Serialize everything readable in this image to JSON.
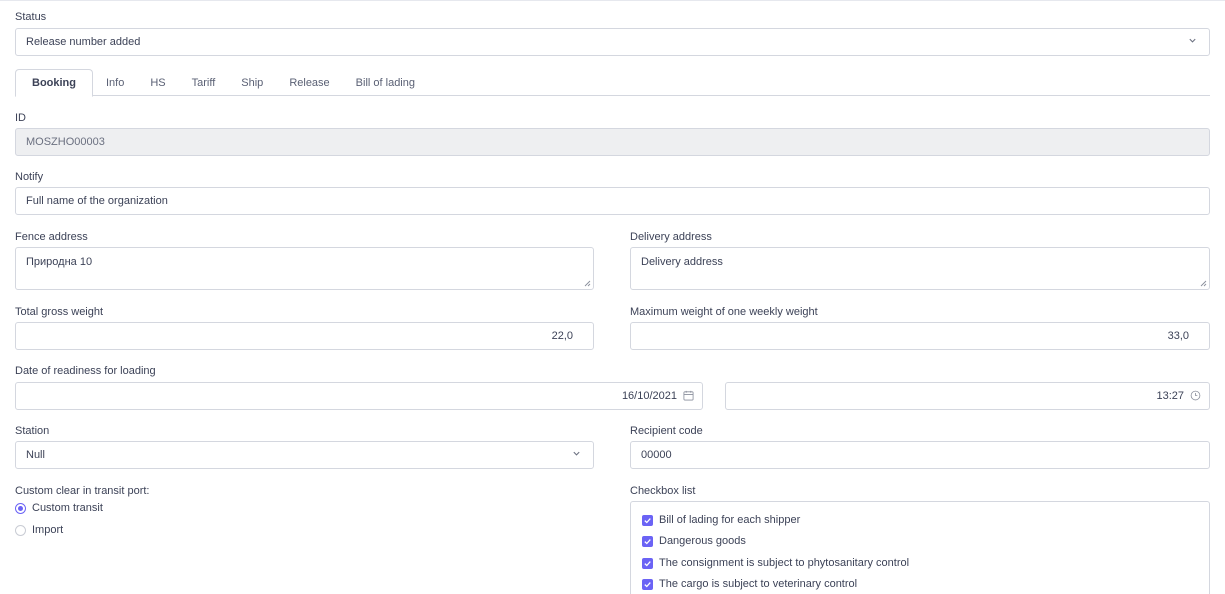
{
  "status": {
    "label": "Status",
    "value": "Release number added"
  },
  "tabs": [
    {
      "label": "Booking",
      "active": true
    },
    {
      "label": "Info"
    },
    {
      "label": "HS"
    },
    {
      "label": "Tariff"
    },
    {
      "label": "Ship"
    },
    {
      "label": "Release"
    },
    {
      "label": "Bill of lading"
    }
  ],
  "id_field": {
    "label": "ID",
    "value": "MOSZHO00003"
  },
  "notify": {
    "label": "Notify",
    "placeholder": "Full name of the organization"
  },
  "fence_address": {
    "label": "Fence address",
    "value": "Природна 10"
  },
  "delivery_address": {
    "label": "Delivery address",
    "placeholder": "Delivery address"
  },
  "total_gross_weight": {
    "label": "Total gross weight",
    "value": "22,0"
  },
  "max_weight": {
    "label": "Maximum weight of one weekly weight",
    "value": "33,0"
  },
  "readiness": {
    "label": "Date of readiness for loading",
    "date": "16/10/2021",
    "time": "13:27"
  },
  "station": {
    "label": "Station",
    "value": "Null"
  },
  "recipient_code": {
    "label": "Recipient code",
    "value": "00000"
  },
  "custom_clear": {
    "label": "Custom clear in transit port:",
    "options": [
      {
        "label": "Custom transit",
        "checked": true
      },
      {
        "label": "Import",
        "checked": false
      }
    ]
  },
  "checkbox_list": {
    "label": "Checkbox list",
    "items": [
      {
        "label": "Bill of lading for each shipper",
        "checked": true
      },
      {
        "label": "Dangerous goods",
        "checked": true
      },
      {
        "label": "The consignment is subject to phytosanitary control",
        "checked": true
      },
      {
        "label": "The cargo is subject to veterinary control",
        "checked": true
      }
    ]
  },
  "colors": {
    "accent": "#6b63f5",
    "border": "#d4d7df",
    "disabled_bg": "#eeeff1",
    "text": "#3c4257"
  },
  "icons": [
    "chevron-down-icon",
    "calendar-icon",
    "clock-icon",
    "check-icon",
    "resize-handle-icon"
  ]
}
